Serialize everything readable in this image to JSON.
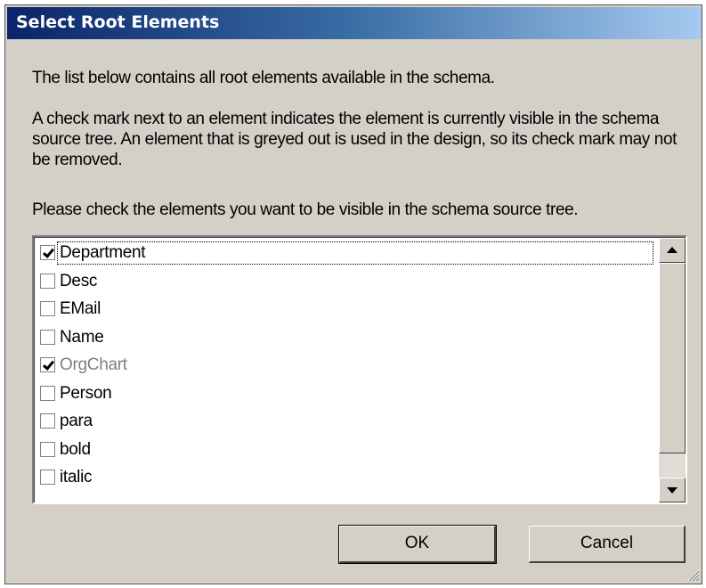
{
  "window": {
    "title": "Select Root Elements"
  },
  "text": {
    "intro": "The list below contains all root elements available in the schema.",
    "explanation": "A check mark next to an element indicates the element is currently visible in the schema source tree. An element that is greyed out is used in the design, so its check mark may not be removed.",
    "instruction": "Please check the elements you want to be visible in the schema source tree."
  },
  "list": {
    "items": [
      {
        "label": "Department",
        "checked": true,
        "disabled": false,
        "focused": true
      },
      {
        "label": "Desc",
        "checked": false,
        "disabled": false,
        "focused": false
      },
      {
        "label": "EMail",
        "checked": false,
        "disabled": false,
        "focused": false
      },
      {
        "label": "Name",
        "checked": false,
        "disabled": false,
        "focused": false
      },
      {
        "label": "OrgChart",
        "checked": true,
        "disabled": true,
        "focused": false
      },
      {
        "label": "Person",
        "checked": false,
        "disabled": false,
        "focused": false
      },
      {
        "label": "para",
        "checked": false,
        "disabled": false,
        "focused": false
      },
      {
        "label": "bold",
        "checked": false,
        "disabled": false,
        "focused": false
      },
      {
        "label": "italic",
        "checked": false,
        "disabled": false,
        "focused": false
      }
    ]
  },
  "buttons": {
    "ok": "OK",
    "cancel": "Cancel"
  },
  "icons": {
    "scroll_up": "scroll-up-arrow-icon",
    "scroll_down": "scroll-down-arrow-icon",
    "resize_grip": "resize-grip-icon",
    "checkmark": "checkmark-icon"
  }
}
